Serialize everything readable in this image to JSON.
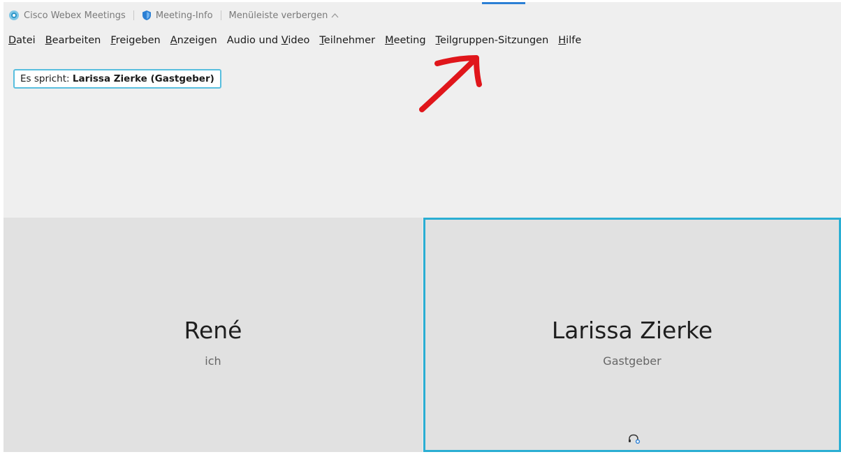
{
  "titlebar": {
    "app_name": "Cisco Webex Meetings",
    "meeting_info": "Meeting-Info",
    "hide_menu": "Menüleiste verbergen"
  },
  "menu": {
    "items": [
      {
        "accel": "D",
        "rest": "atei"
      },
      {
        "accel": "B",
        "rest": "earbeiten"
      },
      {
        "accel": "F",
        "rest": "reigeben"
      },
      {
        "accel": "A",
        "rest": "nzeigen"
      },
      {
        "pre": "Audio und ",
        "accel": "V",
        "rest": "ideo"
      },
      {
        "accel": "T",
        "rest": "eilnehmer"
      },
      {
        "accel": "M",
        "rest": "eeting"
      },
      {
        "accel": "T",
        "rest": "eilgruppen-Sitzungen"
      },
      {
        "accel": "H",
        "rest": "ilfe"
      }
    ]
  },
  "speaking": {
    "prefix": "Es spricht:",
    "name": "Larissa Zierke (Gastgeber)"
  },
  "participants": [
    {
      "name": "René",
      "role": "ich"
    },
    {
      "name": "Larissa Zierke",
      "role": "Gastgeber"
    }
  ],
  "colors": {
    "active_border": "#2aaed3",
    "speaking_border": "#58bede",
    "annotation": "#e0161b",
    "webex_blue": "#2b7fd4"
  },
  "icons": {
    "logo": "webex-logo-icon",
    "shield": "shield-icon",
    "chevron": "chevron-up-icon",
    "arrow": "annotation-arrow-icon",
    "headset": "headset-icon"
  }
}
